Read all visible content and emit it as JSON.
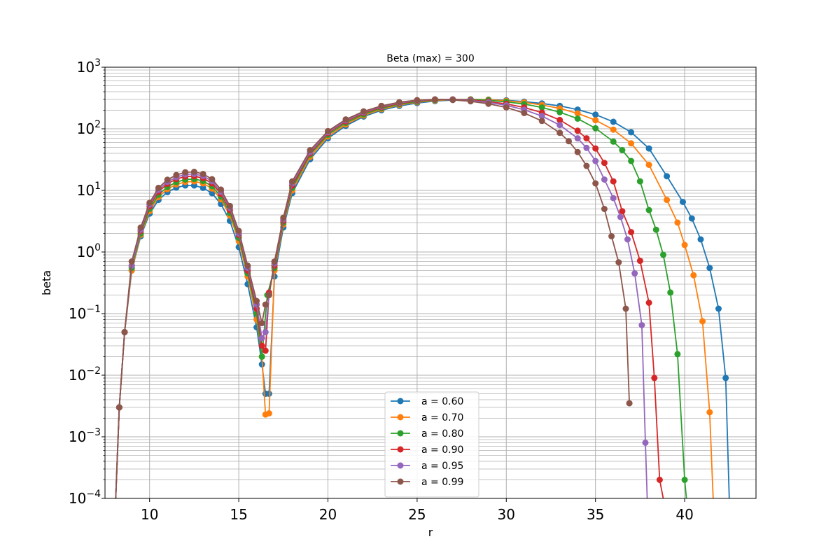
{
  "chart_data": {
    "type": "line",
    "title": "Beta (max) = 300",
    "xlabel": "r",
    "ylabel": "beta",
    "xlim": [
      7.5,
      44
    ],
    "ylim": [
      0.0001,
      1000
    ],
    "yscale": "log",
    "grid": true,
    "legend_position": "lower-center",
    "xticks": [
      {
        "value": 10,
        "label": "10"
      },
      {
        "value": 15,
        "label": "15"
      },
      {
        "value": 20,
        "label": "20"
      },
      {
        "value": 25,
        "label": "25"
      },
      {
        "value": 30,
        "label": "30"
      },
      {
        "value": 35,
        "label": "35"
      },
      {
        "value": 40,
        "label": "40"
      }
    ],
    "yticks": [
      {
        "value": 0.0001,
        "base": "10",
        "exp": "−4"
      },
      {
        "value": 0.001,
        "base": "10",
        "exp": "−3"
      },
      {
        "value": 0.01,
        "base": "10",
        "exp": "−2"
      },
      {
        "value": 0.1,
        "base": "10",
        "exp": "−1"
      },
      {
        "value": 1,
        "base": "10",
        "exp": "0"
      },
      {
        "value": 10,
        "base": "10",
        "exp": "1"
      },
      {
        "value": 100,
        "base": "10",
        "exp": "2"
      },
      {
        "value": 1000,
        "base": "10",
        "exp": "3"
      }
    ],
    "series": [
      {
        "name": "a = 0.60",
        "color": "#1f77b4",
        "params": {
          "peak1": 12,
          "node1": 16.6,
          "peak2": 300,
          "node2": 42.5
        },
        "x": [
          8.1,
          8.3,
          8.6,
          9,
          9.5,
          10,
          10.5,
          11,
          11.5,
          12,
          12.5,
          13,
          13.5,
          14,
          14.5,
          15,
          15.5,
          16,
          16.3,
          16.5,
          16.7,
          17,
          17.5,
          18,
          19,
          20,
          21,
          22,
          23,
          24,
          25,
          26,
          27,
          28,
          29,
          30,
          31,
          32,
          33,
          34,
          35,
          36,
          37,
          38,
          39,
          39.9,
          40.4,
          40.9,
          41.4,
          41.9,
          42.3,
          42.5
        ],
        "y": [
          0.0001,
          0.003,
          0.05,
          0.5,
          1.8,
          4.2,
          7.0,
          9.4,
          11.1,
          12.0,
          12.0,
          11.0,
          9.0,
          6.0,
          3.2,
          1.2,
          0.3,
          0.06,
          0.015,
          0.005,
          0.005,
          0.4,
          2.5,
          9,
          32,
          70,
          112,
          158,
          200,
          235,
          262,
          282,
          294,
          300,
          298,
          290,
          276,
          258,
          235,
          205,
          170,
          130,
          88,
          48,
          17,
          6.5,
          3.5,
          1.6,
          0.55,
          0.12,
          0.009,
          0.0001
        ]
      },
      {
        "name": "a = 0.70",
        "color": "#ff7f0e",
        "params": {
          "peak1": 14,
          "node1": 16.55,
          "peak2": 300,
          "node2": 41.6
        },
        "x": [
          8.1,
          8.3,
          8.6,
          9,
          9.5,
          10,
          10.5,
          11,
          11.5,
          12,
          12.5,
          13,
          13.5,
          14,
          14.5,
          15,
          15.5,
          16,
          16.3,
          16.5,
          16.7,
          17,
          17.5,
          18,
          19,
          20,
          21,
          22,
          23,
          24,
          25,
          26,
          27,
          28,
          29,
          30,
          31,
          32,
          33,
          34,
          35,
          36,
          37,
          38,
          39,
          39.6,
          40,
          40.5,
          41,
          41.4,
          41.6
        ],
        "y": [
          0.0001,
          0.003,
          0.05,
          0.5,
          1.9,
          4.6,
          7.8,
          10.5,
          12.5,
          13.7,
          14.0,
          13.0,
          10.7,
          7.2,
          3.9,
          1.5,
          0.4,
          0.08,
          0.02,
          0.0023,
          0.0024,
          0.5,
          2.8,
          10,
          35,
          75,
          118,
          165,
          208,
          244,
          270,
          288,
          298,
          300,
          296,
          285,
          268,
          244,
          214,
          178,
          138,
          97,
          58,
          26,
          7,
          3,
          1.3,
          0.42,
          0.075,
          0.0025,
          0.0001
        ]
      },
      {
        "name": "a = 0.80",
        "color": "#2ca02c",
        "params": {
          "peak1": 15,
          "node1": 16.5,
          "peak2": 300,
          "node2": 40.1
        },
        "x": [
          8.1,
          8.3,
          8.6,
          9,
          9.5,
          10,
          10.5,
          11,
          11.5,
          12,
          12.5,
          13,
          13.5,
          14,
          14.5,
          15,
          15.5,
          16,
          16.3,
          16.6,
          17,
          17.5,
          18,
          19,
          20,
          21,
          22,
          23,
          24,
          25,
          26,
          27,
          28,
          29,
          30,
          31,
          32,
          33,
          34,
          35,
          36,
          36.5,
          37,
          37.5,
          38,
          38.4,
          38.8,
          39.2,
          39.6,
          40,
          40.1
        ],
        "y": [
          0.0001,
          0.003,
          0.05,
          0.55,
          2.0,
          5.0,
          8.5,
          11.4,
          13.6,
          15.0,
          15.3,
          14.2,
          11.7,
          7.9,
          4.3,
          1.7,
          0.45,
          0.1,
          0.02,
          0.2,
          0.55,
          3,
          11,
          38,
          80,
          125,
          172,
          215,
          251,
          276,
          293,
          300,
          299,
          290,
          274,
          252,
          222,
          186,
          146,
          102,
          62,
          45,
          30,
          14,
          4.8,
          2.3,
          0.9,
          0.22,
          0.022,
          0.0002,
          0.0001
        ]
      },
      {
        "name": "a = 0.90",
        "color": "#d62728",
        "params": {
          "peak1": 17,
          "node1": 16.6,
          "peak2": 300,
          "node2": 38.8
        },
        "x": [
          8.1,
          8.3,
          8.6,
          9,
          9.5,
          10,
          10.5,
          11,
          11.5,
          12,
          12.5,
          13,
          13.5,
          14,
          14.5,
          15,
          15.5,
          16,
          16.3,
          16.5,
          16.7,
          17,
          17.5,
          18,
          19,
          20,
          21,
          22,
          23,
          24,
          25,
          26,
          27,
          28,
          29,
          30,
          31,
          32,
          33,
          34,
          34.5,
          35,
          35.5,
          36,
          36.5,
          37,
          37.5,
          38,
          38.3,
          38.6,
          38.8
        ],
        "y": [
          0.0001,
          0.003,
          0.05,
          0.6,
          2.2,
          5.5,
          9.5,
          12.8,
          15.3,
          16.8,
          17.0,
          15.8,
          13.0,
          8.8,
          4.8,
          1.9,
          0.5,
          0.12,
          0.03,
          0.025,
          0.22,
          0.6,
          3.2,
          12,
          40,
          85,
          132,
          180,
          224,
          259,
          283,
          298,
          300,
          293,
          277,
          254,
          222,
          183,
          139,
          93,
          70,
          48,
          28,
          14,
          4.6,
          2.1,
          0.72,
          0.15,
          0.009,
          0.0002,
          0.0001
        ]
      },
      {
        "name": "a = 0.95",
        "color": "#9467bd",
        "params": {
          "peak1": 18.5,
          "node1": 16.45,
          "peak2": 300,
          "node2": 37.9
        },
        "x": [
          8.1,
          8.3,
          8.6,
          9,
          9.5,
          10,
          10.5,
          11,
          11.5,
          12,
          12.5,
          13,
          13.5,
          14,
          14.5,
          15,
          15.5,
          16,
          16.3,
          16.5,
          16.7,
          17,
          17.5,
          18,
          19,
          20,
          21,
          22,
          23,
          24,
          25,
          26,
          27,
          28,
          29,
          30,
          31,
          32,
          33,
          34,
          34.5,
          35,
          35.5,
          36,
          36.4,
          36.8,
          37.2,
          37.6,
          37.8,
          37.9
        ],
        "y": [
          0.0001,
          0.003,
          0.05,
          0.6,
          2.3,
          5.9,
          10.2,
          13.8,
          16.4,
          18.2,
          18.5,
          17.1,
          14.1,
          9.5,
          5.2,
          2.0,
          0.55,
          0.14,
          0.04,
          0.05,
          0.2,
          0.65,
          3.4,
          13,
          42,
          88,
          137,
          186,
          230,
          265,
          288,
          300,
          298,
          288,
          268,
          240,
          204,
          161,
          115,
          70,
          49,
          30,
          15,
          7.5,
          3.7,
          1.6,
          0.45,
          0.065,
          0.0008,
          0.0001
        ]
      },
      {
        "name": "a = 0.99",
        "color": "#8c564b",
        "params": {
          "peak1": 20,
          "node1": 16.5,
          "peak2": 300,
          "node2": 36.9
        },
        "x": [
          8.1,
          8.3,
          8.6,
          9,
          9.5,
          10,
          10.5,
          11,
          11.5,
          12,
          12.5,
          13,
          13.5,
          14,
          14.5,
          15,
          15.5,
          16,
          16.3,
          16.5,
          16.7,
          17,
          17.5,
          18,
          19,
          20,
          21,
          22,
          23,
          24,
          25,
          26,
          27,
          28,
          29,
          30,
          31,
          32,
          33,
          33.5,
          34,
          34.5,
          35,
          35.5,
          35.9,
          36.3,
          36.7,
          36.9
        ],
        "y": [
          0.0001,
          0.003,
          0.05,
          0.7,
          2.5,
          6.3,
          11.0,
          14.9,
          17.8,
          19.7,
          20.0,
          18.5,
          15.2,
          10.3,
          5.6,
          2.2,
          0.6,
          0.16,
          0.07,
          0.14,
          0.2,
          0.7,
          3.6,
          14,
          45,
          92,
          142,
          192,
          236,
          270,
          292,
          300,
          295,
          280,
          255,
          222,
          180,
          134,
          86,
          63,
          42,
          25,
          13,
          5,
          1.8,
          0.68,
          0.12,
          0.0035
        ]
      }
    ]
  }
}
